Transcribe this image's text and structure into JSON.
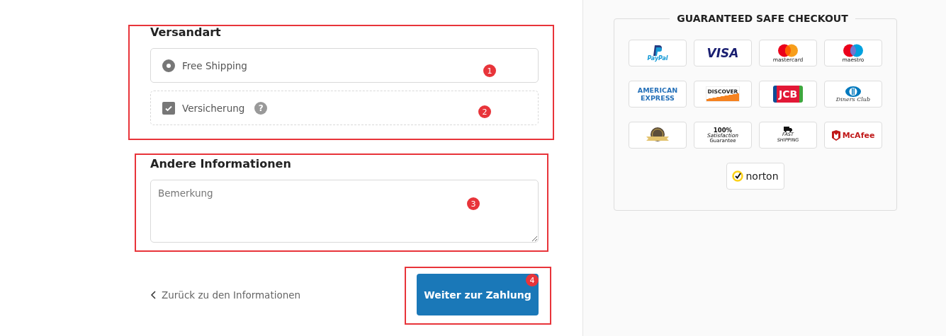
{
  "shipping": {
    "title": "Versandart",
    "options": [
      {
        "kind": "radio",
        "label": "Free Shipping",
        "selected": true
      },
      {
        "kind": "checkbox",
        "label": "Versicherung",
        "checked": true,
        "help": "?"
      }
    ]
  },
  "other_info": {
    "title": "Andere Informationen",
    "remark": {
      "placeholder": "Bemerkung"
    }
  },
  "back_link": "Zurück zu den Informationen",
  "continue_button": "Weiter zur Zahlung",
  "safe_checkout": {
    "title": "GUARANTEED SAFE CHECKOUT",
    "badges": [
      {
        "kind": "paypal",
        "lines": [
          "PayPal"
        ]
      },
      {
        "kind": "visa",
        "lines": [
          "VISA"
        ]
      },
      {
        "kind": "mastercard",
        "lines": [
          "mastercard"
        ]
      },
      {
        "kind": "maestro",
        "lines": [
          "maestro"
        ]
      },
      {
        "kind": "amex",
        "lines": [
          "AMERICAN",
          "EXPRESS"
        ]
      },
      {
        "kind": "discover",
        "lines": [
          "DISCOVER"
        ]
      },
      {
        "kind": "jcb",
        "lines": [
          "JCB"
        ]
      },
      {
        "kind": "diners",
        "lines": [
          "Diners Club"
        ]
      },
      {
        "kind": "seal"
      },
      {
        "kind": "satisfaction",
        "lines": [
          "100%",
          "Satisfaction",
          "Guarantee"
        ]
      },
      {
        "kind": "fast_shipping",
        "lines": [
          "FAST",
          "SHIPPING"
        ]
      },
      {
        "kind": "mcafee",
        "lines": [
          "McAfee"
        ]
      },
      {
        "kind": "norton",
        "lines": [
          "norton"
        ]
      }
    ]
  },
  "annotations": [
    {
      "number": "1"
    },
    {
      "number": "2"
    },
    {
      "number": "3"
    },
    {
      "number": "4"
    }
  ]
}
